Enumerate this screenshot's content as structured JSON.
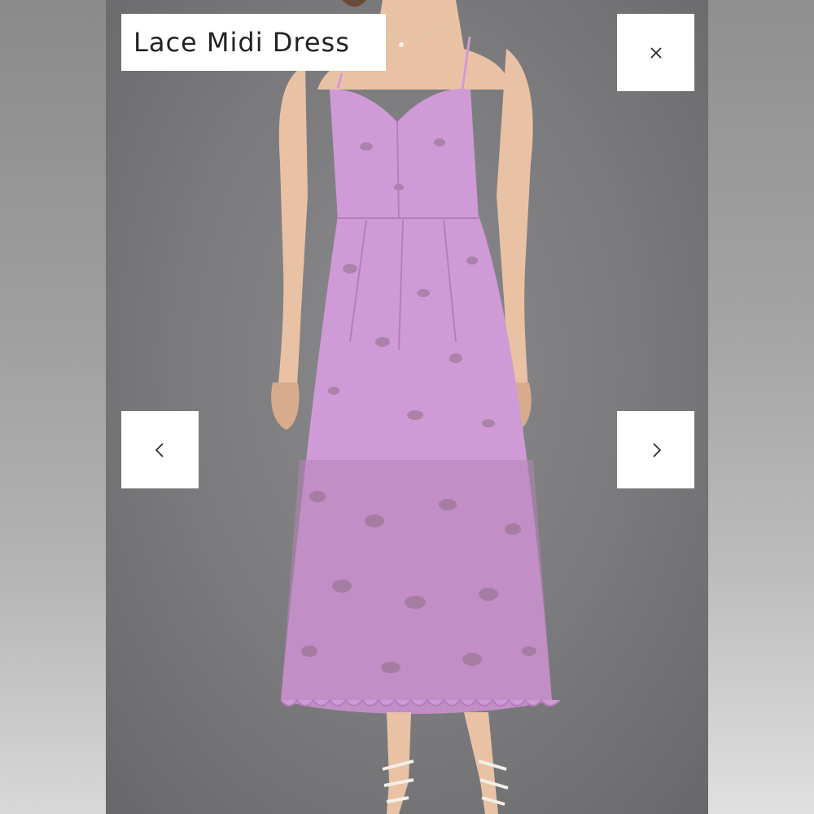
{
  "viewer": {
    "title": "Lace Midi Dress",
    "controls": {
      "close_icon": "close-icon",
      "prev_icon": "chevron-left-icon",
      "next_icon": "chevron-right-icon"
    }
  },
  "colors": {
    "dress": "#cf9bd6",
    "backdrop": "#7c7c7e",
    "control_bg": "#ffffff"
  }
}
